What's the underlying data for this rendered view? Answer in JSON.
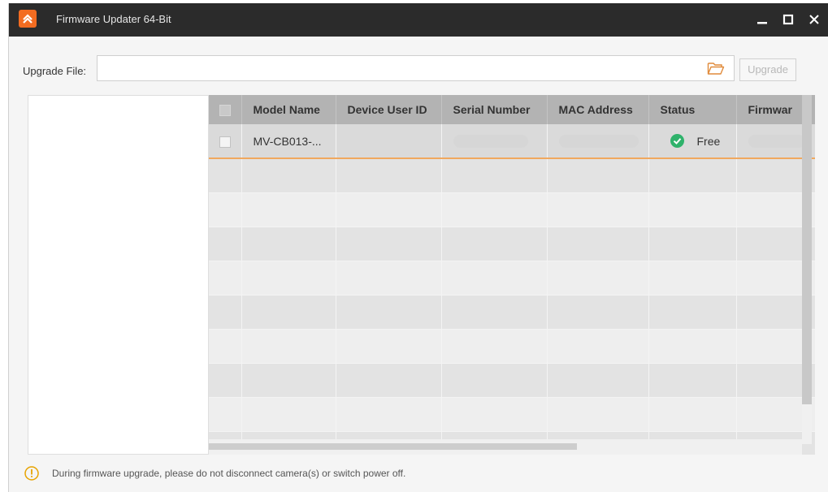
{
  "window": {
    "title": "Firmware Updater 64-Bit"
  },
  "toolbar": {
    "upgrade_file_label": "Upgrade File:",
    "upgrade_file_value": "",
    "upgrade_button": "Upgrade"
  },
  "table": {
    "columns": [
      "Model Name",
      "Device User ID",
      "Serial Number",
      "MAC Address",
      "Status",
      "Firmwar"
    ],
    "rows": [
      {
        "model_name": "MV-CB013-...",
        "device_user_id": "",
        "status": "Free",
        "checked": false
      }
    ]
  },
  "footer": {
    "warning": "During firmware upgrade, please do not disconnect camera(s) or switch power off."
  },
  "colors": {
    "accent": "#f36c21",
    "title_bar": "#2b2b2b",
    "status_ok": "#2fb26b",
    "selection_line": "#f0a85e"
  },
  "icons": [
    "app-logo-icon",
    "minimize-icon",
    "maximize-icon",
    "close-icon",
    "folder-open-icon",
    "check-circle-icon",
    "warning-icon"
  ]
}
